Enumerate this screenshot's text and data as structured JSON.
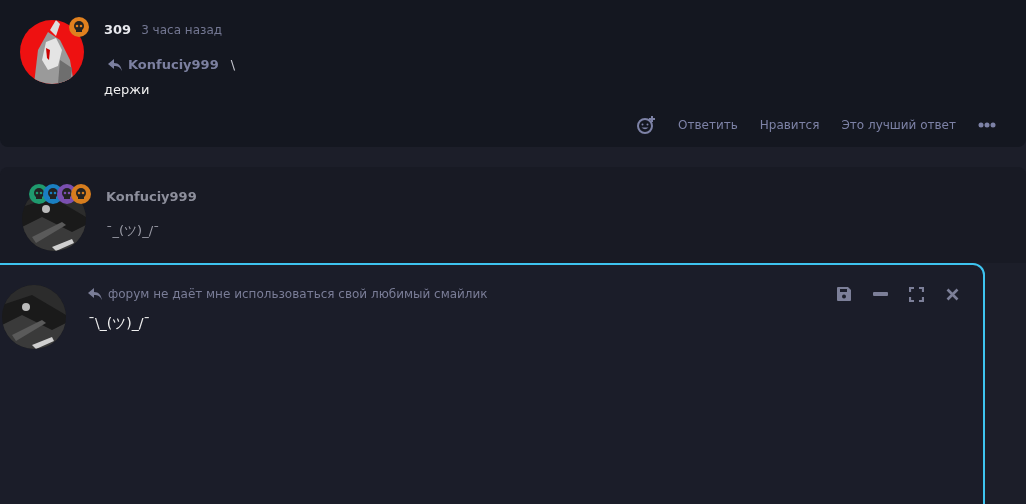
{
  "post": {
    "author": "309",
    "time": "3 часа назад",
    "badges": [
      {
        "color": "#e0801e"
      }
    ],
    "quote": {
      "author": "Konfuciy999",
      "text": "\\"
    },
    "text": "держи",
    "actions": [
      {
        "kind": "react"
      },
      {
        "kind": "text",
        "label": "Ответить"
      },
      {
        "kind": "text",
        "label": "Нравится"
      },
      {
        "kind": "text",
        "label": "Это лучший ответ"
      },
      {
        "kind": "more"
      }
    ]
  },
  "reply": {
    "author": "Konfuciy999",
    "badges": [
      {
        "color": "#1f9a6e"
      },
      {
        "color": "#1a7fc1"
      },
      {
        "color": "#7a4fb0"
      },
      {
        "color": "#d67d1e"
      }
    ],
    "text": "¯_(ツ)_/¯"
  },
  "editor": {
    "reply_to": "форум не даёт мне использоваться свой любимый смайлик",
    "value": "¯\\_(ツ)_/¯",
    "tools": [
      {
        "kind": "save"
      },
      {
        "kind": "minimize"
      },
      {
        "kind": "expand"
      },
      {
        "kind": "close"
      }
    ]
  }
}
